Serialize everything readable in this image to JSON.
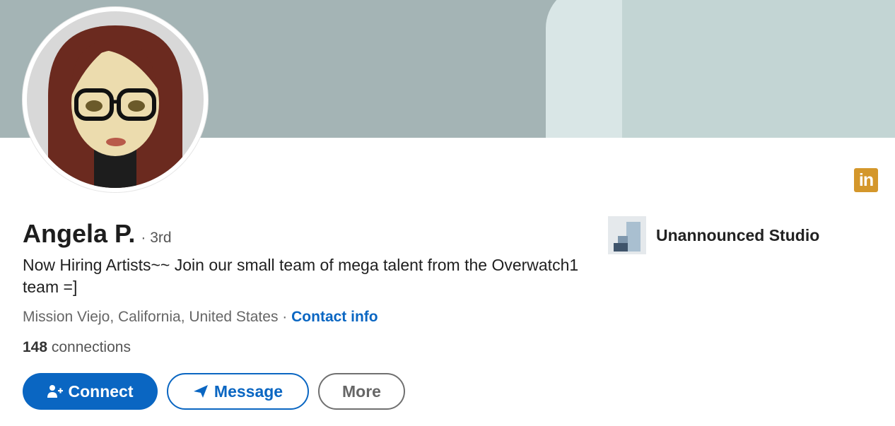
{
  "profile": {
    "name": "Angela P.",
    "degree": "· 3rd",
    "headline": "Now Hiring Artists~~ Join our small team of mega talent from the Overwatch1 team =]",
    "location": "Mission Viejo, California, United States",
    "separator": " · ",
    "contact_label": "Contact info",
    "connections_count": "148",
    "connections_label": " connections"
  },
  "company": {
    "name": "Unannounced Studio"
  },
  "actions": {
    "connect": "Connect",
    "message": "Message",
    "more": "More"
  },
  "brand": {
    "icon_text": "in",
    "accent": "#0a66c2",
    "badge_color": "#d4972b"
  },
  "icons": [
    "linkedin-icon",
    "add-person-icon",
    "send-icon",
    "company-logo"
  ]
}
